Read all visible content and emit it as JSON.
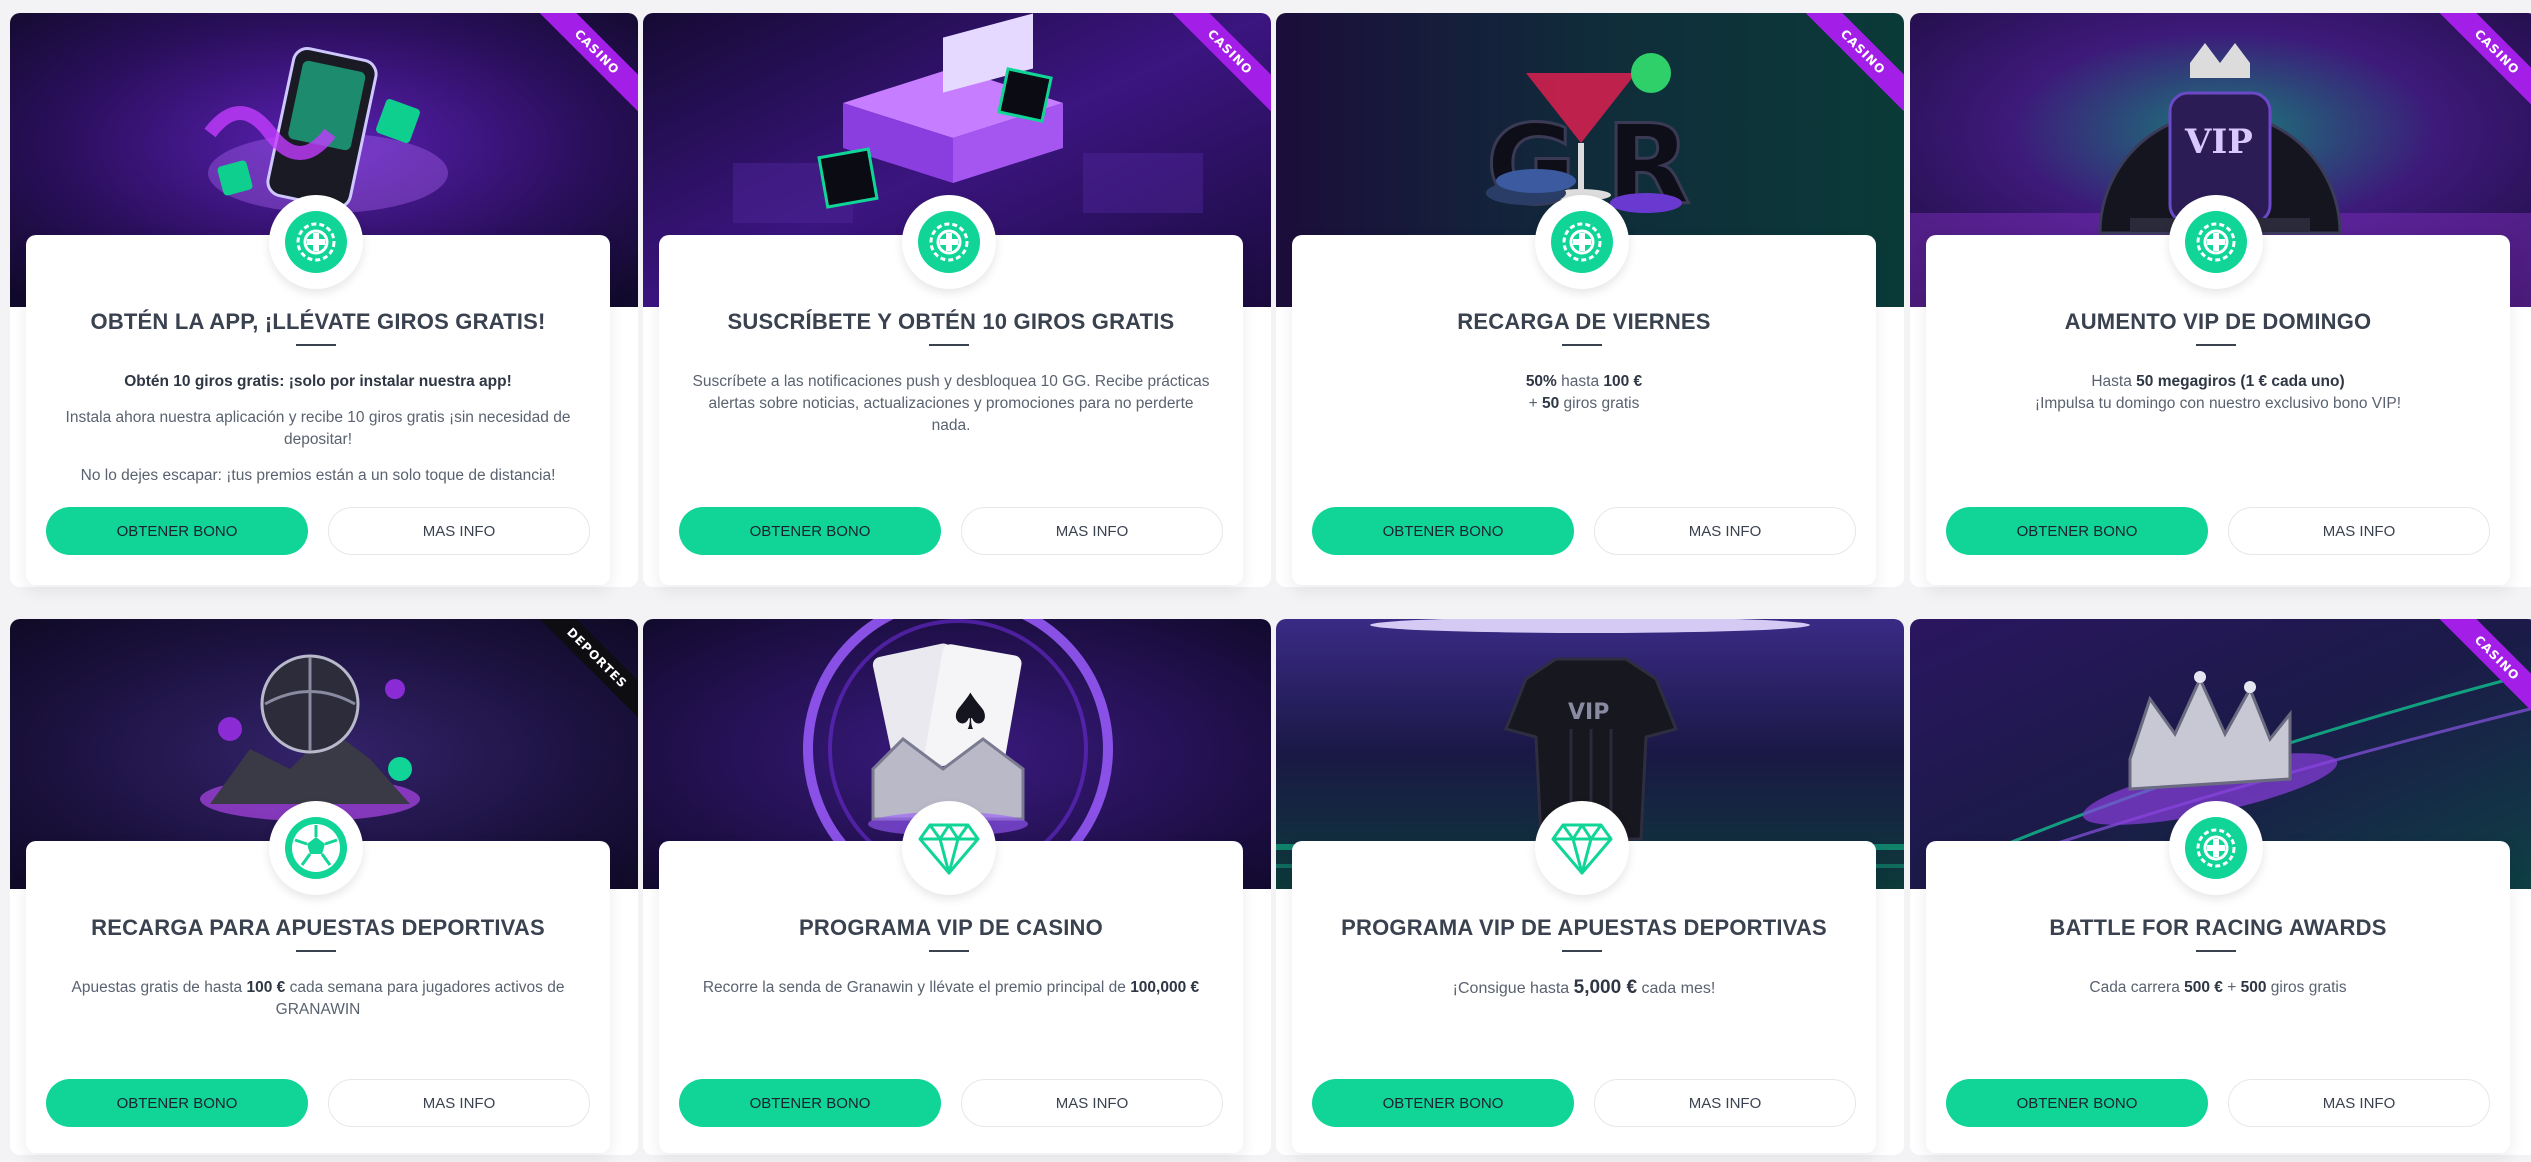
{
  "colors": {
    "accent": "#10d597",
    "ribbon_casino": "#a31fe8",
    "ribbon_sports": "#0d0d12"
  },
  "buttons": {
    "primary_label": "OBTENER BONO",
    "secondary_label": "MAS INFO"
  },
  "cards": [
    {
      "ribbon": "CASINO",
      "icon": "roulette-chip-icon",
      "title": "OBTÉN LA APP, ¡LLÉVATE GIROS GRATIS!",
      "lead": "Obtén 10 giros gratis: ¡solo por instalar nuestra app!",
      "line1": "Instala ahora nuestra aplicación y recibe 10 giros gratis ¡sin necesidad de depositar!",
      "line2": "No lo dejes escapar: ¡tus premios están a un solo toque de distancia!"
    },
    {
      "ribbon": "CASINO",
      "icon": "roulette-chip-icon",
      "title": "SUSCRÍBETE Y OBTÉN 10 GIROS GRATIS",
      "line1": "Suscríbete a las notificaciones push y desbloquea 10 GG. Recibe prácticas alertas sobre noticias, actualizaciones y promociones para no perderte nada."
    },
    {
      "ribbon": "CASINO",
      "icon": "roulette-chip-icon",
      "title": "RECARGA DE VIERNES",
      "pct": "50%",
      "pct_text": " hasta ",
      "amount": "100 €",
      "plus": "+ ",
      "spins": "50",
      "spins_text": " giros gratis"
    },
    {
      "ribbon": "CASINO",
      "icon": "roulette-chip-icon",
      "title": "AUMENTO VIP DE DOMINGO",
      "pre": "Hasta ",
      "bold": "50 megagiros (1 € cada uno)",
      "line2": "¡Impulsa tu domingo con nuestro exclusivo bono VIP!"
    },
    {
      "ribbon": "DEPORTES",
      "icon": "soccer-ball-icon",
      "title": "RECARGA PARA APUESTAS DEPORTIVAS",
      "pre": "Apuestas gratis de hasta ",
      "bold": "100 €",
      "post": " cada semana para jugadores activos de GRANAWIN"
    },
    {
      "icon": "diamond-icon",
      "title": "PROGRAMA VIP DE CASINO",
      "pre": "Recorre la senda de Granawin y llévate el premio principal de ",
      "bold": "100,000 €"
    },
    {
      "icon": "diamond-icon",
      "title": "PROGRAMA VIP DE APUESTAS DEPORTIVAS",
      "pre": "¡Consigue hasta ",
      "bold": "5,000 €",
      "post": " cada mes!"
    },
    {
      "ribbon": "CASINO",
      "icon": "roulette-chip-icon",
      "title": "BATTLE FOR RACING AWARDS",
      "pre": "Cada carrera ",
      "bold": "500 €",
      "mid": " + ",
      "bold2": "500",
      "post": " giros gratis"
    }
  ]
}
